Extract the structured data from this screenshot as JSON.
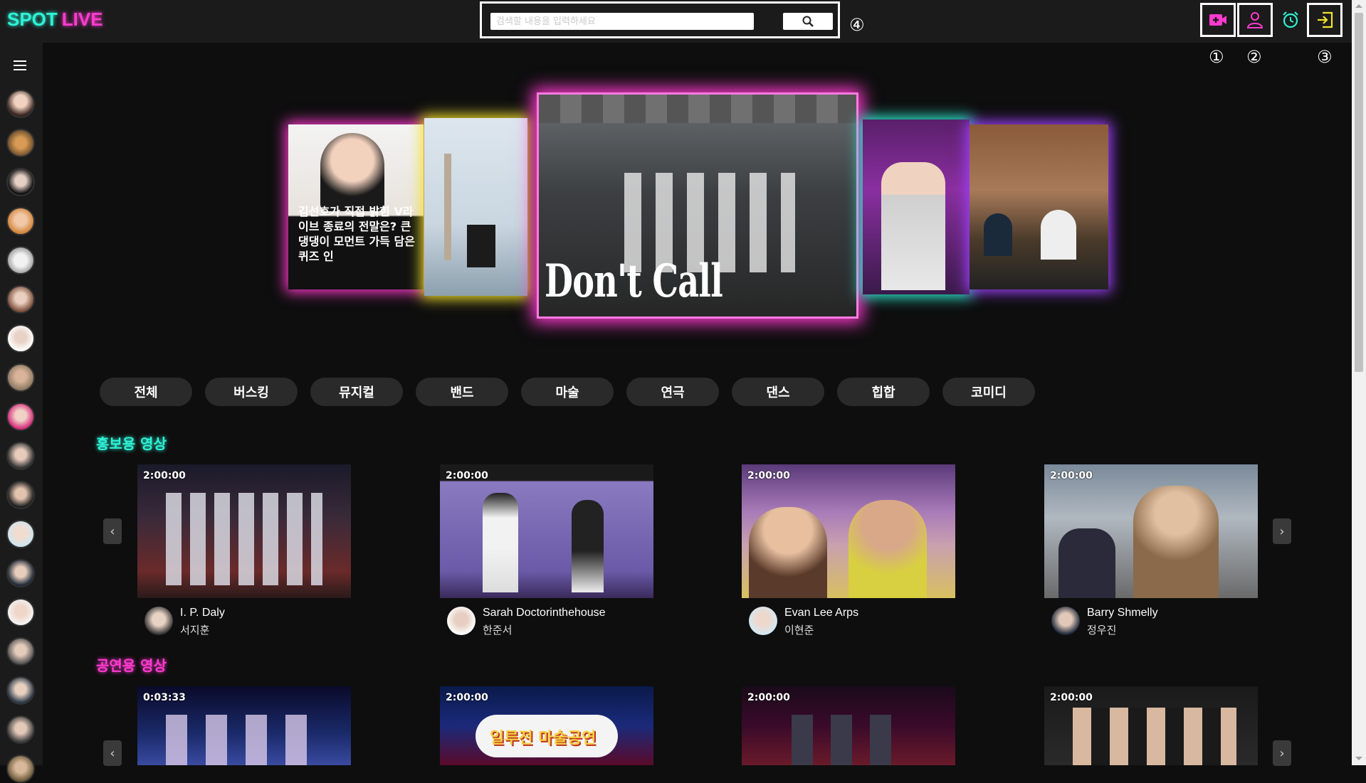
{
  "app": {
    "logo_part1": "SPOT",
    "logo_part2": "LIVE"
  },
  "search": {
    "placeholder": "검색할 내용을 입력하세요",
    "annotation": "④"
  },
  "header_icons": [
    {
      "name": "video-add-icon",
      "annotation": "①",
      "color": "#ff3ad0"
    },
    {
      "name": "user-icon",
      "annotation": "②",
      "color": "#ff3ad0"
    },
    {
      "name": "alarm-icon",
      "annotation": "",
      "color": "#2ef2d6"
    },
    {
      "name": "login-icon",
      "annotation": "③",
      "color": "#f2e22e"
    }
  ],
  "carousel": {
    "slide1_text": "김선호가 직접 밝힌 V라이브 종료의 전말은? 큰 댕댕이 모먼트 가득 담은 퀴즈 인",
    "slide3_text": "Don't Call Me"
  },
  "categories": [
    "전체",
    "버스킹",
    "뮤지컬",
    "밴드",
    "마술",
    "연극",
    "댄스",
    "힙합",
    "코미디"
  ],
  "promo": {
    "title": "홍보용 영상",
    "cards": [
      {
        "duration": "2:00:00",
        "name": "I. P. Daly",
        "sub": "서지훈"
      },
      {
        "duration": "2:00:00",
        "name": "Sarah Doctorinthehouse",
        "sub": "한준서"
      },
      {
        "duration": "2:00:00",
        "name": "Evan Lee Arps",
        "sub": "이현준"
      },
      {
        "duration": "2:00:00",
        "name": "Barry Shmelly",
        "sub": "정우진"
      }
    ]
  },
  "performance": {
    "title": "공연용 영상",
    "cards": [
      {
        "duration": "0:03:33"
      },
      {
        "duration": "2:00:00",
        "poster_text": "일루전 마술공연"
      },
      {
        "duration": "2:00:00"
      },
      {
        "duration": "2:00:00"
      }
    ]
  },
  "colors": {
    "accent_cyan": "#2ef2d6",
    "accent_pink": "#ff3ad0",
    "accent_yellow": "#f2e22e"
  }
}
